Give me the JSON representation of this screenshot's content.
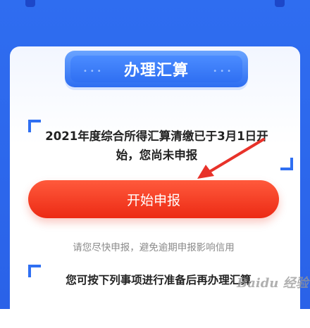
{
  "card": {
    "title": "办理汇算",
    "message": "2021年度综合所得汇算清缴已于3月1日开始，您尚未申报",
    "start_button": "开始申报",
    "hint": "请您尽快申报，避免逾期申报影响信用",
    "prep_note": "您可按下列事项进行准备后再办理汇算"
  },
  "watermark": {
    "text": "Baidu 经验"
  },
  "colors": {
    "primary_blue": "#2f6ff2",
    "button_red": "#ec2a14",
    "arrow_red": "#e8322a"
  }
}
